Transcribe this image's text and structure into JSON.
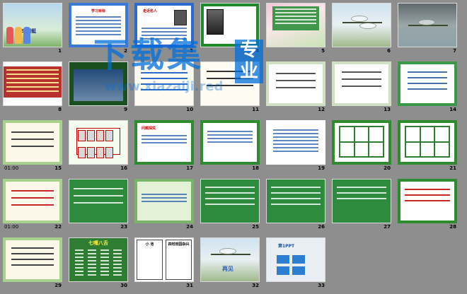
{
  "slides": [
    {
      "n": "1",
      "kind": "cover",
      "label": "19 蜻蜓"
    },
    {
      "n": "2",
      "kind": "blueframe",
      "label": "学习目标"
    },
    {
      "n": "3",
      "kind": "author",
      "label": "走近名人"
    },
    {
      "n": "4",
      "kind": "green",
      "label": ""
    },
    {
      "n": "5",
      "kind": "lotus",
      "label": ""
    },
    {
      "n": "6",
      "kind": "dragon",
      "label": ""
    },
    {
      "n": "7",
      "kind": "dragon2",
      "label": ""
    },
    {
      "n": "8",
      "kind": "redband",
      "label": ""
    },
    {
      "n": "9",
      "kind": "shrimp",
      "label": ""
    },
    {
      "n": "10",
      "kind": "paper",
      "label": ""
    },
    {
      "n": "11",
      "kind": "paper",
      "label": ""
    },
    {
      "n": "12",
      "kind": "list",
      "label": ""
    },
    {
      "n": "13",
      "kind": "list",
      "label": ""
    },
    {
      "n": "14",
      "kind": "framed",
      "label": ""
    },
    {
      "n": "15",
      "kind": "bamboo",
      "label": ""
    },
    {
      "n": "16",
      "kind": "chars",
      "label": ""
    },
    {
      "n": "17",
      "kind": "green2",
      "label": "问题探究"
    },
    {
      "n": "18",
      "kind": "green2",
      "label": ""
    },
    {
      "n": "19",
      "kind": "plain",
      "label": ""
    },
    {
      "n": "20",
      "kind": "table",
      "label": ""
    },
    {
      "n": "21",
      "kind": "table",
      "label": ""
    },
    {
      "n": "22",
      "kind": "greenfull",
      "label": ""
    },
    {
      "n": "23",
      "kind": "greenfull",
      "label": ""
    },
    {
      "n": "24",
      "kind": "blank-green",
      "label": ""
    },
    {
      "n": "25",
      "kind": "greenfull",
      "label": ""
    },
    {
      "n": "26",
      "kind": "greenfull",
      "label": ""
    },
    {
      "n": "27",
      "kind": "greenfull",
      "label": ""
    },
    {
      "n": "28",
      "kind": "redtext",
      "label": ""
    },
    {
      "n": "29",
      "kind": "bamboo",
      "label": ""
    },
    {
      "n": "30",
      "kind": "sevenmouth",
      "label": "七嘴八舌"
    },
    {
      "n": "31",
      "kind": "split",
      "label": "小 池",
      "label2": "四时田园杂兴"
    },
    {
      "n": "32",
      "kind": "dragon",
      "label": "再见"
    },
    {
      "n": "33",
      "kind": "ad",
      "label": "第1PPT"
    }
  ],
  "timing": {
    "15": "01:00",
    "22": "01:00"
  },
  "watermark": {
    "main": "下载集",
    "side": "专业",
    "url": "www.xiazaiji.red"
  }
}
